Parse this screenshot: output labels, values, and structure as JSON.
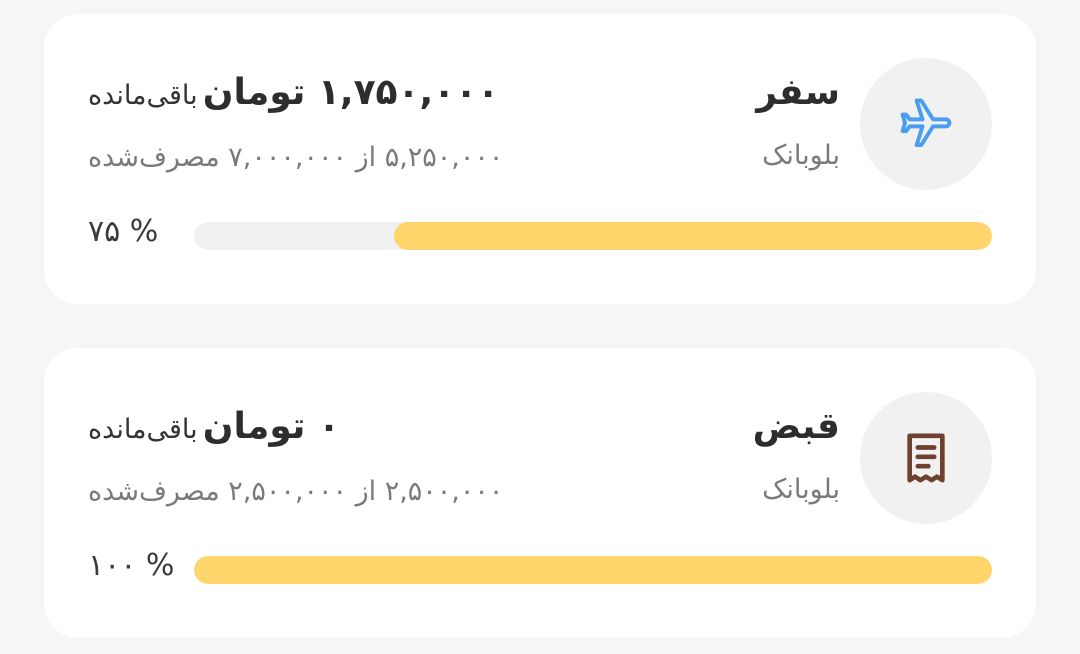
{
  "budgets": [
    {
      "title": "سفر",
      "bank": "بلوبانک",
      "icon": "airplane-icon",
      "icon_color": "#4a9ef0",
      "remaining_amount": "۱,۷۵۰,۰۰۰ تومان",
      "remaining_suffix": "باقی‌مانده",
      "spent_text": "۵,۲۵۰,۰۰۰ از ۷,۰۰۰,۰۰۰ مصرف‌شده",
      "percent_text": "% ۷۵",
      "progress": 0.75
    },
    {
      "title": "قبض",
      "bank": "بلوبانک",
      "icon": "receipt-icon",
      "icon_color": "#6e4030",
      "remaining_amount": "۰ تومان",
      "remaining_suffix": "باقی‌مانده",
      "spent_text": "۲,۵۰۰,۰۰۰ از ۲,۵۰۰,۰۰۰ مصرف‌شده",
      "percent_text": "% ۱۰۰",
      "progress": 1.0
    }
  ],
  "colors": {
    "background": "#f6f6f6",
    "card": "#ffffff",
    "progress_fill": "#ffd56c",
    "progress_track": "#f1f1f1"
  }
}
